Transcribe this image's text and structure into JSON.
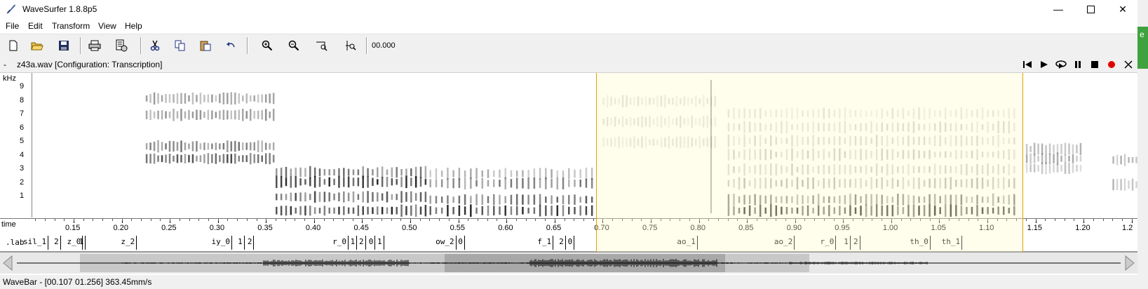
{
  "window": {
    "title": "WaveSurfer 1.8.8p5"
  },
  "menu": [
    "File",
    "Edit",
    "Transform",
    "View",
    "Help"
  ],
  "toolbar": {
    "time_readout": "00.000"
  },
  "pane": {
    "dash": "-",
    "title": "z43a.wav [Configuration: Transcription]"
  },
  "spectrogram": {
    "unit": "kHz",
    "ticks": [
      "9",
      "8",
      "7",
      "6",
      "5",
      "4",
      "3",
      "2",
      "1"
    ]
  },
  "time_axis": {
    "label": "time",
    "start": 0.107,
    "end": 1.256,
    "ticks": [
      "0.15",
      "0.20",
      "0.25",
      "0.30",
      "0.35",
      "0.40",
      "0.45",
      "0.50",
      "0.55",
      "0.60",
      "0.65",
      "0.70",
      "0.75",
      "0.80",
      "0.85",
      "0.90",
      "0.95",
      "1.00",
      "1.05",
      "1.10",
      "1.15",
      "1.20",
      "1.2"
    ]
  },
  "selection": {
    "start": 0.693,
    "end": 1.136
  },
  "labels": {
    "track": ".lab",
    "segments": [
      {
        "t": 0.123,
        "text": "sil_1"
      },
      {
        "t": 0.136,
        "text": "2"
      },
      {
        "t": 0.159,
        "text": "z_0"
      },
      {
        "t": 0.162,
        "text": "1"
      },
      {
        "t": 0.215,
        "text": "z_2"
      },
      {
        "t": 0.314,
        "text": "iy_0"
      },
      {
        "t": 0.327,
        "text": "1"
      },
      {
        "t": 0.337,
        "text": "2"
      },
      {
        "t": 0.435,
        "text": "r_0"
      },
      {
        "t": 0.444,
        "text": "1"
      },
      {
        "t": 0.453,
        "text": "2"
      },
      {
        "t": 0.463,
        "text": "0"
      },
      {
        "t": 0.472,
        "text": "1"
      },
      {
        "t": 0.547,
        "text": "ow_2"
      },
      {
        "t": 0.556,
        "text": "0"
      },
      {
        "t": 0.648,
        "text": "f_1"
      },
      {
        "t": 0.661,
        "text": "2"
      },
      {
        "t": 0.67,
        "text": "0"
      },
      {
        "t": 0.798,
        "text": "ao_1"
      },
      {
        "t": 0.899,
        "text": "ao_2"
      },
      {
        "t": 0.942,
        "text": "r_0"
      },
      {
        "t": 0.957,
        "text": "1"
      },
      {
        "t": 0.967,
        "text": "2"
      },
      {
        "t": 1.04,
        "text": "th_0"
      },
      {
        "t": 1.073,
        "text": "th_1"
      }
    ]
  },
  "status": "WaveBar - [00.107 01.256] 363.45mm/s",
  "side": {
    "text": "e"
  }
}
